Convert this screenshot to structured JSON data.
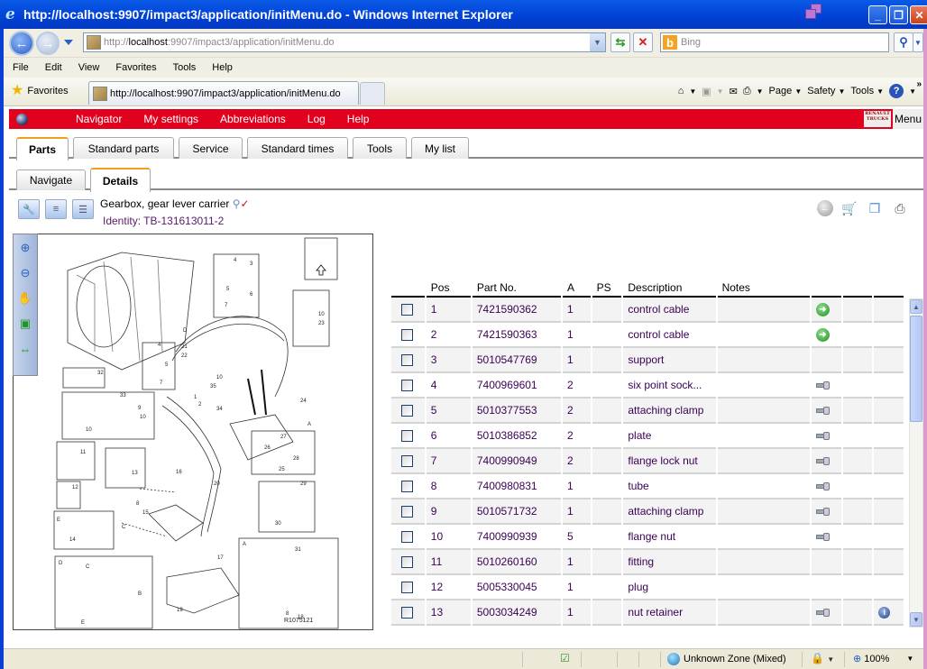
{
  "window": {
    "title": "http://localhost:9907/impact3/application/initMenu.do - Windows Internet Explorer",
    "controls": {
      "minimize": "_",
      "restore": "❐",
      "close": "✕"
    }
  },
  "address_bar": {
    "url_prefix": "http://",
    "url_host": "localhost",
    "url_rest": ":9907/impact3/application/initMenu.do",
    "search_placeholder": "Bing"
  },
  "menu_bar": [
    "File",
    "Edit",
    "View",
    "Favorites",
    "Tools",
    "Help"
  ],
  "favorites_bar": {
    "favorites_label": "Favorites",
    "tab_title": "http://localhost:9907/impact3/application/initMenu.do",
    "commands": [
      "Page",
      "Safety",
      "Tools"
    ]
  },
  "app_nav": {
    "items": [
      "Navigator",
      "My settings",
      "Abbreviations",
      "Log",
      "Help"
    ],
    "logo_text": "RENAULT TRUCKS",
    "menu_label": "Menu",
    "accent_color": "#e1001e"
  },
  "main_tabs": [
    {
      "label": "Parts",
      "active": true
    },
    {
      "label": "Standard parts",
      "active": false
    },
    {
      "label": "Service",
      "active": false
    },
    {
      "label": "Standard times",
      "active": false
    },
    {
      "label": "Tools",
      "active": false
    },
    {
      "label": "My list",
      "active": false
    }
  ],
  "sub_tabs": [
    {
      "label": "Navigate",
      "active": false
    },
    {
      "label": "Details",
      "active": true
    }
  ],
  "detail": {
    "title": "Gearbox, gear lever carrier",
    "identity_label": "Identity:",
    "identity_value": "TB-131613011-2",
    "drawing_ref": "R1075121"
  },
  "table": {
    "headers": [
      "",
      "Pos",
      "Part No.",
      "A",
      "PS",
      "Description",
      "Notes",
      "",
      "",
      ""
    ],
    "rows": [
      {
        "pos": "1",
        "part": "7421590362",
        "a": "1",
        "ps": "",
        "desc": "control cable",
        "notes": "",
        "icon": "go",
        "info": false
      },
      {
        "pos": "2",
        "part": "7421590363",
        "a": "1",
        "ps": "",
        "desc": "control cable",
        "notes": "",
        "icon": "go",
        "info": false
      },
      {
        "pos": "3",
        "part": "5010547769",
        "a": "1",
        "ps": "",
        "desc": "support",
        "notes": "",
        "icon": "",
        "info": false
      },
      {
        "pos": "4",
        "part": "7400969601",
        "a": "2",
        "ps": "",
        "desc": "six point sock...",
        "notes": "",
        "icon": "bolt",
        "info": false
      },
      {
        "pos": "5",
        "part": "5010377553",
        "a": "2",
        "ps": "",
        "desc": "attaching clamp",
        "notes": "",
        "icon": "bolt",
        "info": false
      },
      {
        "pos": "6",
        "part": "5010386852",
        "a": "2",
        "ps": "",
        "desc": "plate",
        "notes": "",
        "icon": "bolt",
        "info": false
      },
      {
        "pos": "7",
        "part": "7400990949",
        "a": "2",
        "ps": "",
        "desc": "flange lock nut",
        "notes": "",
        "icon": "bolt",
        "info": false
      },
      {
        "pos": "8",
        "part": "7400980831",
        "a": "1",
        "ps": "",
        "desc": "tube",
        "notes": "",
        "icon": "bolt",
        "info": false
      },
      {
        "pos": "9",
        "part": "5010571732",
        "a": "1",
        "ps": "",
        "desc": "attaching clamp",
        "notes": "",
        "icon": "bolt",
        "info": false
      },
      {
        "pos": "10",
        "part": "7400990939",
        "a": "5",
        "ps": "",
        "desc": "flange nut",
        "notes": "",
        "icon": "bolt",
        "info": false
      },
      {
        "pos": "11",
        "part": "5010260160",
        "a": "1",
        "ps": "",
        "desc": "fitting",
        "notes": "",
        "icon": "",
        "info": false
      },
      {
        "pos": "12",
        "part": "5005330045",
        "a": "1",
        "ps": "",
        "desc": "plug",
        "notes": "",
        "icon": "",
        "info": false
      },
      {
        "pos": "13",
        "part": "5003034249",
        "a": "1",
        "ps": "",
        "desc": "nut retainer",
        "notes": "",
        "icon": "bolt",
        "info": true
      }
    ]
  },
  "status_bar": {
    "zone": "Unknown Zone (Mixed)",
    "zoom": "100%"
  }
}
